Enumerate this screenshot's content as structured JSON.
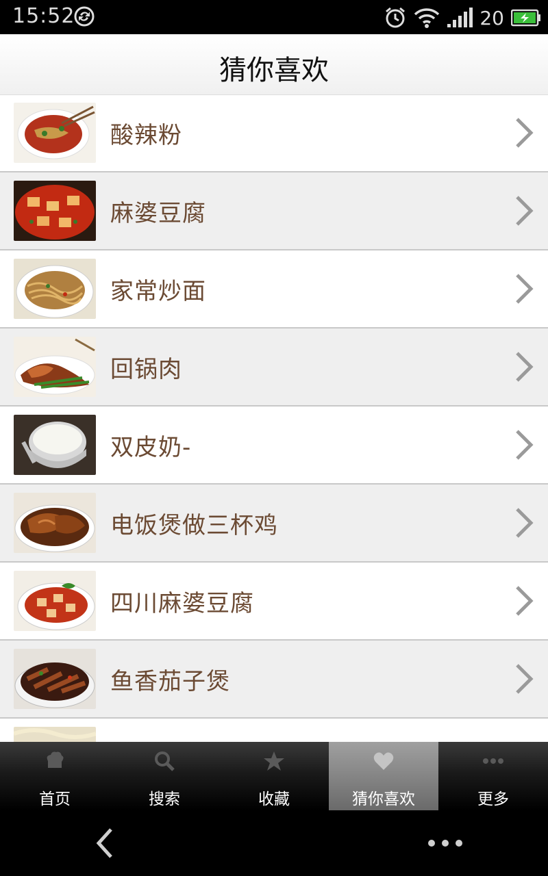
{
  "status_bar": {
    "time": "15:52",
    "battery_level": "20",
    "icons": [
      "sync-icon",
      "alarm-icon",
      "wifi-icon",
      "signal-icon",
      "battery-icon"
    ]
  },
  "header": {
    "title": "猜你喜欢"
  },
  "list": {
    "items": [
      {
        "label": "酸辣粉",
        "thumb": "hot-sour-noodles-image"
      },
      {
        "label": "麻婆豆腐",
        "thumb": "mapo-tofu-image"
      },
      {
        "label": "家常炒面",
        "thumb": "fried-noodles-image"
      },
      {
        "label": "回锅肉",
        "thumb": "twice-cooked-pork-image"
      },
      {
        "label": "双皮奶-",
        "thumb": "milk-pudding-image"
      },
      {
        "label": "电饭煲做三杯鸡",
        "thumb": "three-cup-chicken-image"
      },
      {
        "label": "四川麻婆豆腐",
        "thumb": "sichuan-mapo-tofu-image"
      },
      {
        "label": "鱼香茄子煲",
        "thumb": "eggplant-pot-image"
      },
      {
        "label": "",
        "thumb": "noodle-dish-image"
      }
    ]
  },
  "tab_bar": {
    "tabs": [
      {
        "label": "首页",
        "icon": "chef-hat-icon"
      },
      {
        "label": "搜索",
        "icon": "search-icon"
      },
      {
        "label": "收藏",
        "icon": "star-icon"
      },
      {
        "label": "猜你喜欢",
        "icon": "heart-icon"
      },
      {
        "label": "更多",
        "icon": "more-dots-icon"
      }
    ],
    "active_index": 3
  },
  "nav_bar": {
    "icons": [
      "back-icon",
      "overflow-menu-icon"
    ]
  },
  "colors": {
    "item_text": "#6b4a33",
    "row_alt_bg": "#efefef",
    "tab_active": "#8a8a8a"
  }
}
